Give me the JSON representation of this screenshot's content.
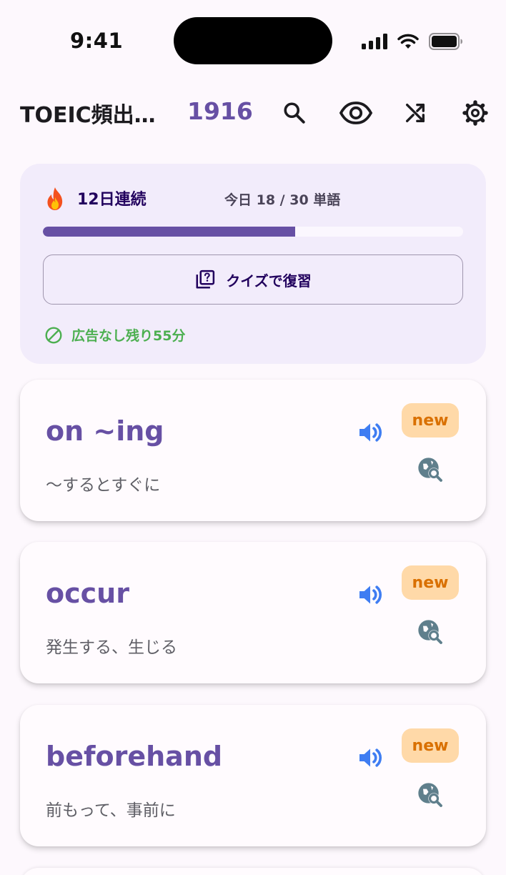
{
  "status_bar": {
    "time": "9:41"
  },
  "app_bar": {
    "title": "TOEIC頻出…",
    "word_count": "1916",
    "icons": [
      "search-icon",
      "eye-icon",
      "shuffle-icon",
      "gear-icon"
    ]
  },
  "progress_card": {
    "streak_emoji": "fire-icon",
    "streak_label": "12日連続",
    "today_label": "今日 18 / 30 単語",
    "progress_fraction": 0.6,
    "quiz_button_label": "クイズで復習",
    "ad_free_label": "広告なし残り55分"
  },
  "words": [
    {
      "word": "on ~ing",
      "meaning": "～するとすぐに",
      "badge": "new"
    },
    {
      "word": "occur",
      "meaning": "発生する、生じる",
      "badge": "new"
    },
    {
      "word": "beforehand",
      "meaning": "前もって、事前に",
      "badge": "new"
    }
  ],
  "colors": {
    "primary": "#6750a4",
    "card_bg": "#f2ecfb",
    "badge_bg": "#ffd9a8",
    "badge_text": "#d97000",
    "speaker": "#3f7df2",
    "ad_free": "#4caf50"
  }
}
